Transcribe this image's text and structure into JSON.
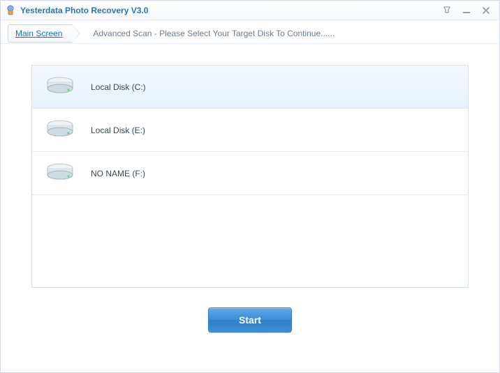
{
  "window": {
    "title": "Yesterdata Photo Recovery V3.0"
  },
  "breadcrumb": {
    "main_label": "Main Screen",
    "step_label": "Advanced Scan - Please Select Your Target Disk To Continue......"
  },
  "disks": [
    {
      "label": "Local Disk (C:)",
      "selected": true
    },
    {
      "label": "Local Disk (E:)",
      "selected": false
    },
    {
      "label": "NO NAME (F:)",
      "selected": false
    }
  ],
  "actions": {
    "start_label": "Start"
  }
}
